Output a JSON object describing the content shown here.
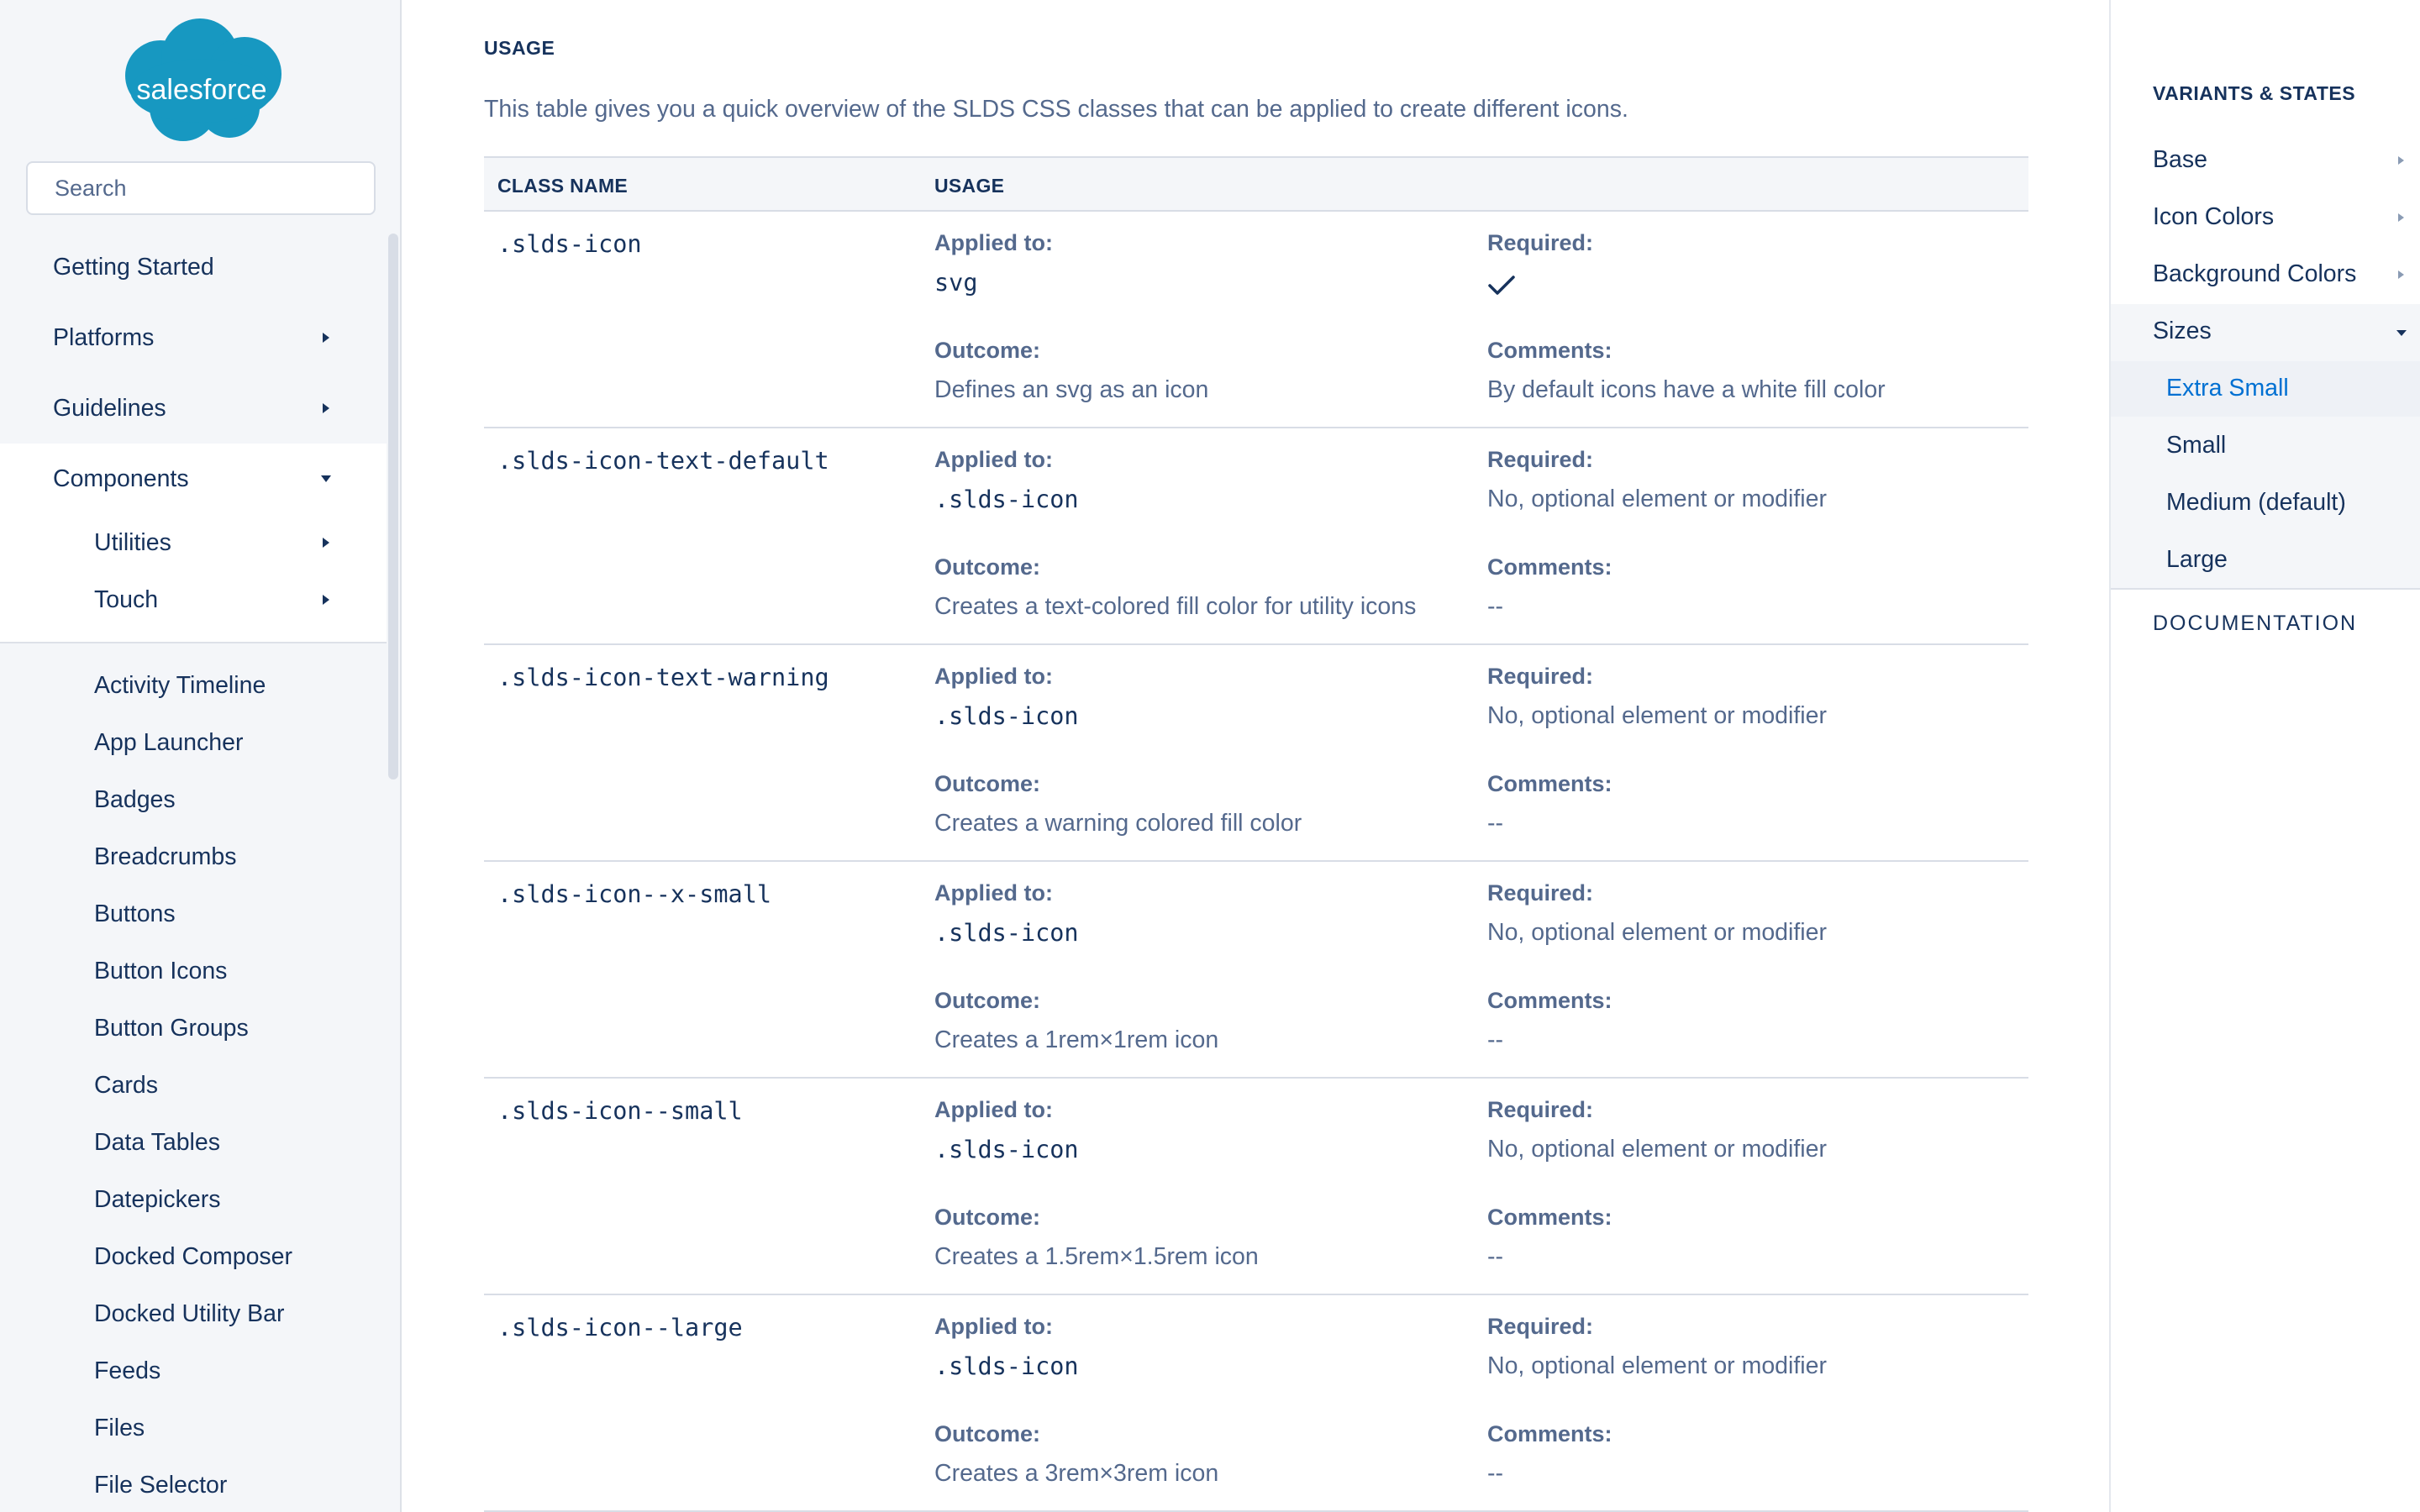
{
  "brand": {
    "logo_text": "salesforce",
    "color": "#1798c1"
  },
  "search": {
    "placeholder": "Search"
  },
  "sidebar": {
    "top_items": [
      {
        "label": "Getting Started"
      },
      {
        "label": "Platforms"
      },
      {
        "label": "Guidelines"
      },
      {
        "label": "Components"
      }
    ],
    "sub_items": [
      {
        "label": "Utilities"
      },
      {
        "label": "Touch"
      }
    ],
    "components": [
      "Activity Timeline",
      "App Launcher",
      "Badges",
      "Breadcrumbs",
      "Buttons",
      "Button Icons",
      "Button Groups",
      "Cards",
      "Data Tables",
      "Datepickers",
      "Docked Composer",
      "Docked Utility Bar",
      "Feeds",
      "Files",
      "File Selector"
    ]
  },
  "main": {
    "heading": "USAGE",
    "intro": "This table gives you a quick overview of the SLDS CSS classes that can be applied to create different icons.",
    "table": {
      "headers": [
        "CLASS NAME",
        "USAGE"
      ],
      "labels": {
        "applied": "Applied to:",
        "required": "Required:",
        "outcome": "Outcome:",
        "comments": "Comments:"
      },
      "rows": [
        {
          "class_name": ".slds-icon",
          "applied_to": "svg",
          "required": "",
          "required_icon": "checkmark-icon",
          "outcome": "Defines an svg as an icon",
          "comments": "By default icons have a white fill color"
        },
        {
          "class_name": ".slds-icon-text-default",
          "applied_to": ".slds-icon",
          "required": "No, optional element or modifier",
          "outcome": "Creates a text-colored fill color for utility icons",
          "comments": "--"
        },
        {
          "class_name": ".slds-icon-text-warning",
          "applied_to": ".slds-icon",
          "required": "No, optional element or modifier",
          "outcome": "Creates a warning colored fill color",
          "comments": "--"
        },
        {
          "class_name": ".slds-icon--x-small",
          "applied_to": ".slds-icon",
          "required": "No, optional element or modifier",
          "outcome": "Creates a 1rem×1rem icon",
          "comments": "--"
        },
        {
          "class_name": ".slds-icon--small",
          "applied_to": ".slds-icon",
          "required": "No, optional element or modifier",
          "outcome": "Creates a 1.5rem×1.5rem icon",
          "comments": "--"
        },
        {
          "class_name": ".slds-icon--large",
          "applied_to": ".slds-icon",
          "required": "No, optional element or modifier",
          "outcome": "Creates a 3rem×3rem icon",
          "comments": "--"
        }
      ]
    }
  },
  "right_nav": {
    "heading": "VARIANTS & STATES",
    "items": [
      {
        "label": "Base"
      },
      {
        "label": "Icon Colors"
      },
      {
        "label": "Background Colors"
      },
      {
        "label": "Sizes"
      }
    ],
    "sub_items": [
      {
        "label": "Extra Small",
        "active": true
      },
      {
        "label": "Small"
      },
      {
        "label": "Medium (default)"
      },
      {
        "label": "Large"
      }
    ],
    "documentation": "DOCUMENTATION"
  },
  "colors": {
    "text_dark": "#16325c",
    "text_muted": "#54698d",
    "link_active": "#0070d2",
    "sidebar_bg": "#f4f6f9"
  }
}
